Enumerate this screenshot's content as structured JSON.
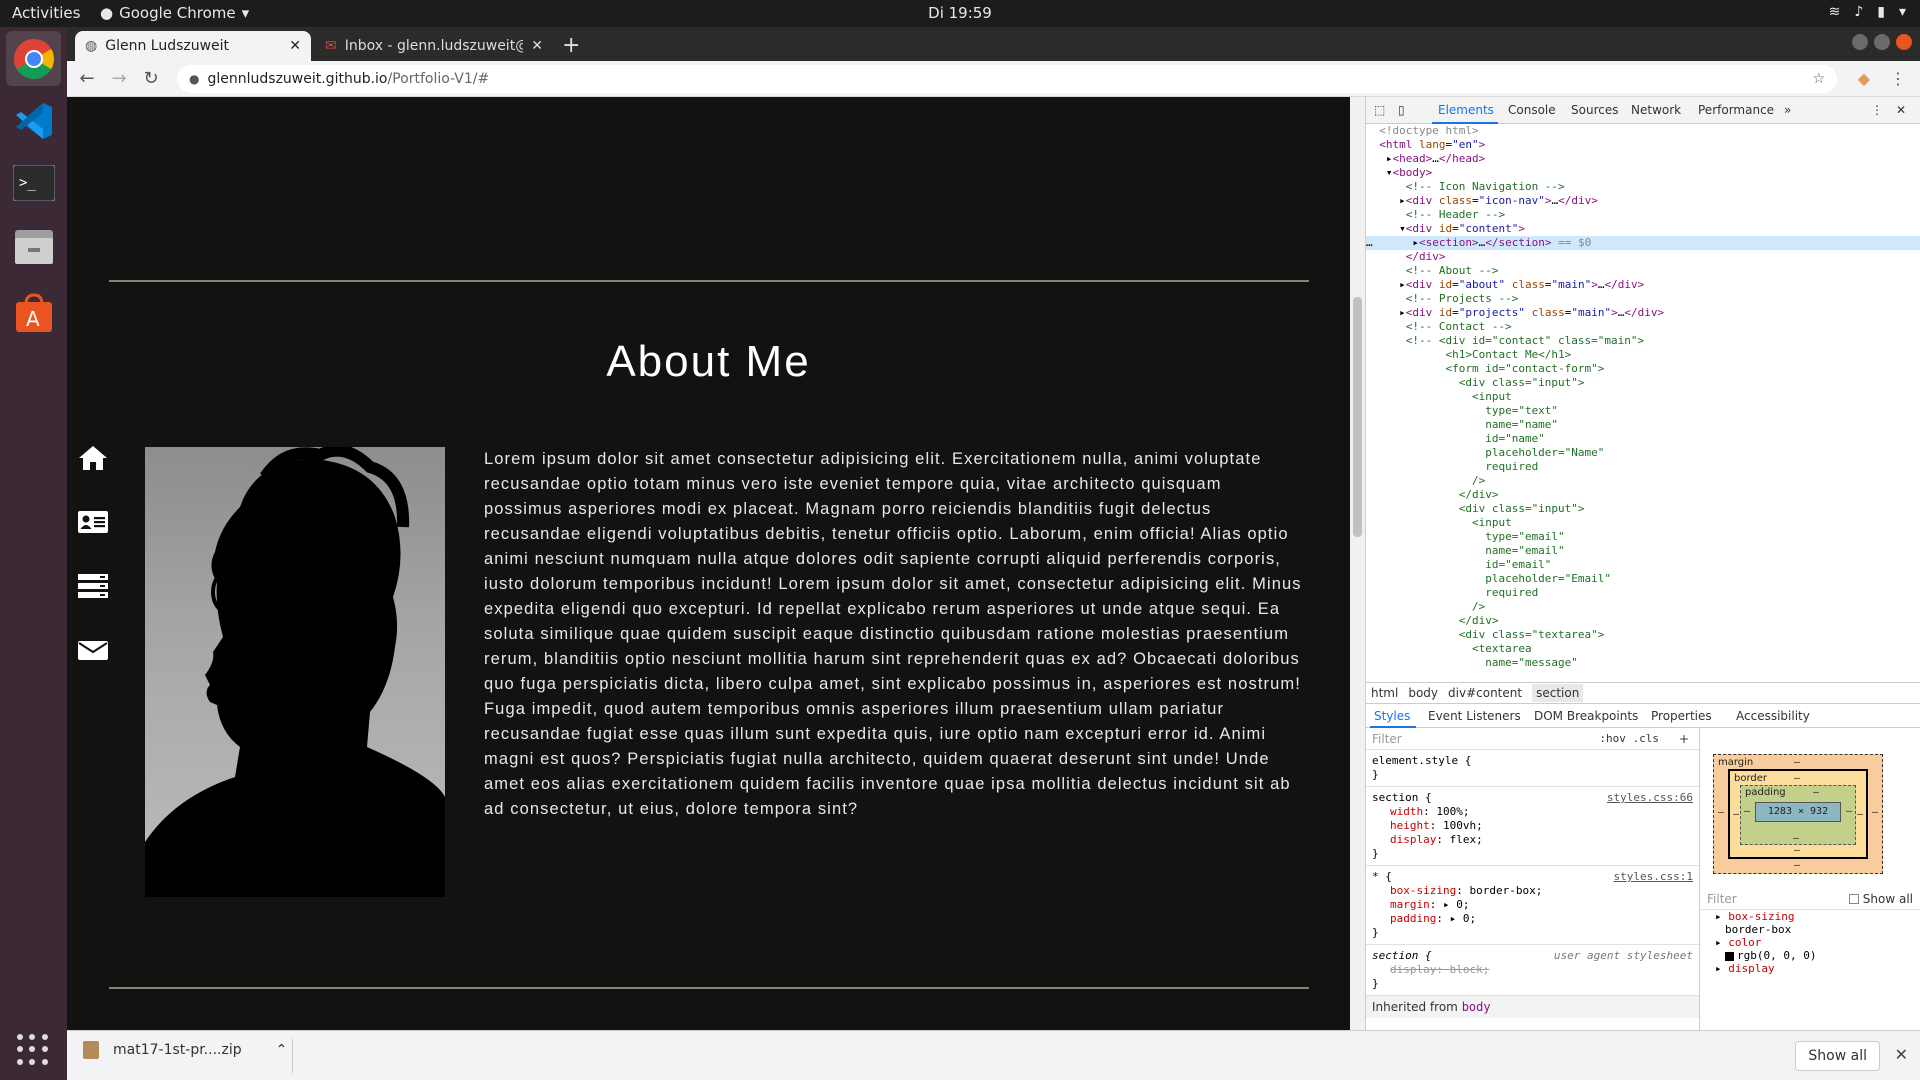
{
  "topbar": {
    "activities": "Activities",
    "app_name": "Google Chrome",
    "clock": "Di 19:59"
  },
  "tabs": [
    {
      "title": "Glenn Ludszuweit",
      "active": true
    },
    {
      "title": "Inbox - glenn.ludszuweit@",
      "active": false
    }
  ],
  "address": {
    "host": "glennludszuweit.github.io",
    "path": "/Portfolio-V1/#"
  },
  "page": {
    "title": "About Me",
    "text": "Lorem ipsum dolor sit amet consectetur adipisicing elit. Exercitationem nulla, animi voluptate recusandae optio totam minus vero iste eveniet tempore quia, vitae architecto quisquam possimus asperiores modi ex placeat. Magnam porro reiciendis blanditiis fugit delectus recusandae eligendi voluptatibus debitis, tenetur officiis optio. Laborum, enim officia! Alias optio animi nesciunt numquam nulla atque dolores odit sapiente corrupti aliquid perferendis corporis, iusto dolorum temporibus incidunt! Lorem ipsum dolor sit amet, consectetur adipisicing elit. Minus expedita eligendi quo excepturi. Id repellat explicabo rerum asperiores ut unde atque sequi. Ea soluta similique quae quidem suscipit eaque distinctio quibusdam ratione molestias praesentium rerum, blanditiis optio nesciunt mollitia harum sint reprehenderit quas ex ad? Obcaecati doloribus quo fuga perspiciatis dicta, libero culpa amet, sint explicabo possimus in, asperiores est nostrum! Fuga impedit, quod autem temporibus omnis asperiores illum praesentium ullam pariatur recusandae fugiat esse quas illum sunt expedita quis, iure optio nam excepturi error id. Animi magni est quos? Perspiciatis fugiat nulla architecto, quidem quaerat deserunt sint unde! Unde amet eos alias exercitationem quidem facilis inventore quae ipsa mollitia delectus incidunt sit ab ad consectetur, ut eius, dolore tempora sint?",
    "nav_icons": [
      "home-icon",
      "contact-card-icon",
      "projects-icon",
      "mail-icon"
    ]
  },
  "devtools": {
    "tabs": [
      "Elements",
      "Console",
      "Sources",
      "Network",
      "Performance"
    ],
    "breadcrumbs": [
      "html",
      "body",
      "div#content",
      "section"
    ],
    "style_tabs": [
      "Styles",
      "Event Listeners",
      "DOM Breakpoints",
      "Properties",
      "Accessibility"
    ],
    "filter_placeholder": "Filter",
    "hov_cls": ":hov .cls",
    "rules": [
      {
        "selector": "element.style {",
        "source": "",
        "props": []
      },
      {
        "selector": "section {",
        "source": "styles.css:66",
        "props": [
          [
            "width",
            "100%;"
          ],
          [
            "height",
            "100vh;"
          ],
          [
            "display",
            "flex;"
          ]
        ]
      },
      {
        "selector": "* {",
        "source": "styles.css:1",
        "props": [
          [
            "box-sizing",
            "border-box;"
          ],
          [
            "margin",
            "▸ 0;"
          ],
          [
            "padding",
            "▸ 0;"
          ]
        ]
      }
    ],
    "ua_rule": {
      "selector": "section {",
      "source": "user agent stylesheet",
      "prop": "display: block;"
    },
    "inherited_label": "Inherited from",
    "inherited_tag": "body",
    "boxmodel": {
      "margin_label": "margin",
      "border_label": "border",
      "padding_label": "padding",
      "dash": "–",
      "content": "1283 × 932"
    },
    "computed": {
      "filter": "Filter",
      "show_all": "Show all",
      "rows": [
        {
          "name": "box-sizing",
          "value": "border-box"
        },
        {
          "name": "color",
          "value": "rgb(0, 0, 0)"
        },
        {
          "name": "display",
          "value": ""
        }
      ]
    }
  },
  "download": {
    "filename": "mat17-1st-pr....zip",
    "show_all": "Show all"
  }
}
